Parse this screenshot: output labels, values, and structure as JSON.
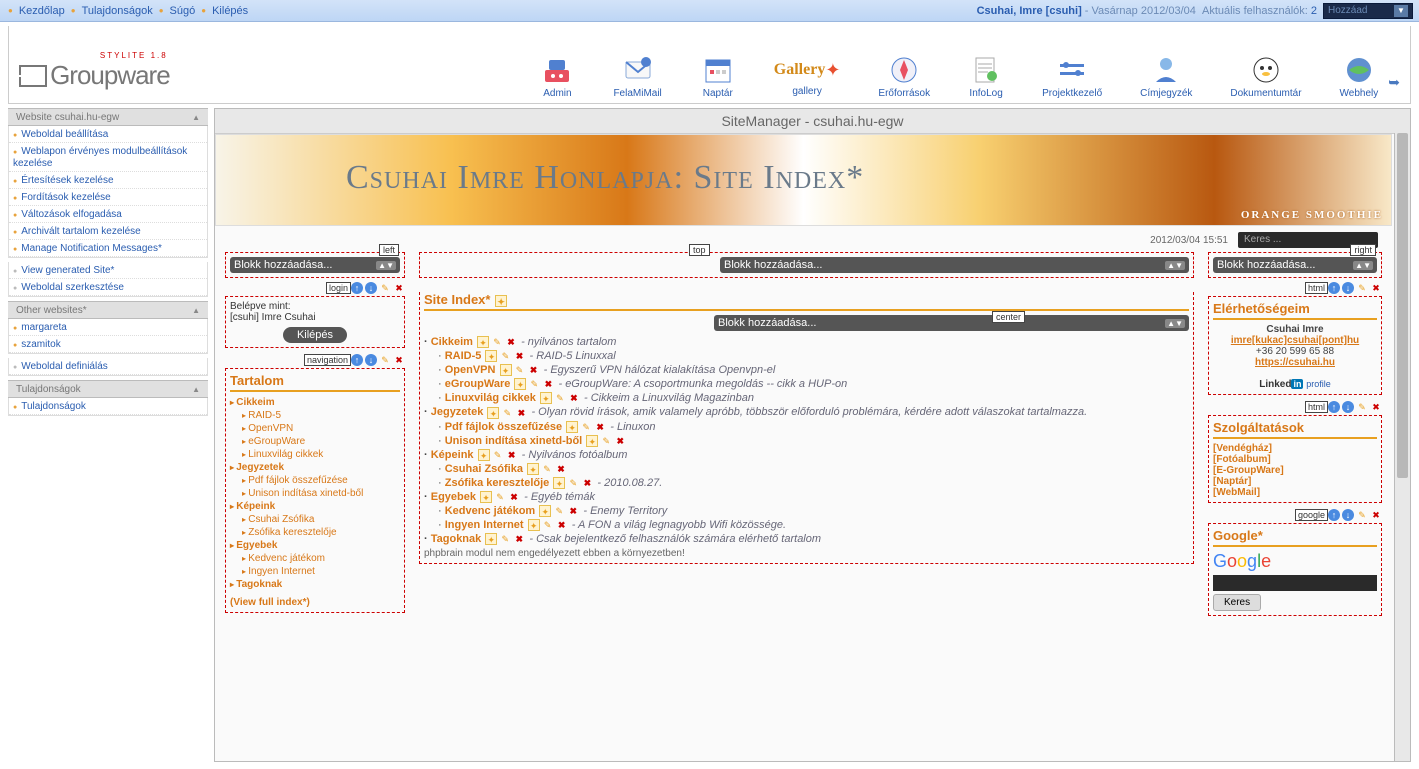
{
  "topbar": {
    "links": [
      "Kezdőlap",
      "Tulajdonságok",
      "Súgó",
      "Kilépés"
    ],
    "user_label": "Csuhai, Imre [csuhi]",
    "date_label": " - Vasárnap 2012/03/04",
    "users_label": "Aktuális felhasználók:",
    "users_count": "2",
    "dropdown": "Hozzáad"
  },
  "logo": {
    "sub": "STYLITE 1.8",
    "text": "Groupware"
  },
  "apps": [
    {
      "label": "Admin"
    },
    {
      "label": "FelaMiMail"
    },
    {
      "label": "Naptár"
    },
    {
      "label": "gallery"
    },
    {
      "label": "Erőforrások"
    },
    {
      "label": "InfoLog"
    },
    {
      "label": "Projektkezelő"
    },
    {
      "label": "Címjegyzék"
    },
    {
      "label": "Dokumentumtár"
    },
    {
      "label": "Webhely"
    }
  ],
  "sidebar": {
    "section1": {
      "title": "Website csuhai.hu-egw",
      "items": [
        "Weboldal beállítása",
        "Weblapon érvényes modulbeállítások kezelése",
        "Értesítések kezelése",
        "Fordítások kezelése",
        "Változások elfogadása",
        "Archivált tartalom kezelése",
        "Manage Notification Messages*"
      ],
      "items2": [
        "View generated Site*",
        "Weboldal szerkesztése"
      ]
    },
    "section2": {
      "title": "Other websites*",
      "items": [
        "margareta",
        "szamitok"
      ],
      "items2": [
        "Weboldal definiálás"
      ]
    },
    "section3": {
      "title": "Tulajdonságok",
      "items": [
        "Tulajdonságok"
      ]
    }
  },
  "main": {
    "title": "SiteManager - csuhai.hu-egw",
    "banner_title": "Csuhai Imre Honlapja: Site Index*",
    "banner_brand": "ORANGE SMOOTHIE",
    "timestamp": "2012/03/04 15:51",
    "search_placeholder": "Keres ...",
    "add_block": "Blokk hozzáadása..."
  },
  "zones": {
    "left": "left",
    "top": "top",
    "right": "right",
    "center": "center"
  },
  "left_blocks": {
    "login": {
      "tag": "login",
      "text1": "Belépve mint:",
      "text2": "[csuhi] Imre Csuhai",
      "btn": "Kilépés"
    },
    "nav": {
      "tag": "navigation",
      "title": "Tartalom",
      "footer": "(View full index*)",
      "items": [
        {
          "t": "Cikkeim",
          "sub": [
            "RAID-5",
            "OpenVPN",
            "eGroupWare",
            "Linuxvilág cikkek"
          ]
        },
        {
          "t": "Jegyzetek",
          "sub": [
            "Pdf fájlok összefűzése",
            "Unison indítása xinetd-ből"
          ]
        },
        {
          "t": "Képeink",
          "sub": [
            "Csuhai Zsófika",
            "Zsófika keresztelője"
          ]
        },
        {
          "t": "Egyebek",
          "sub": [
            "Kedvenc játékom",
            "Ingyen Internet"
          ]
        },
        {
          "t": "Tagoknak",
          "sub": []
        }
      ]
    }
  },
  "center": {
    "title": "Site Index*",
    "items": [
      {
        "lvl": 1,
        "t": "Cikkeim",
        "d": "nyilvános tartalom"
      },
      {
        "lvl": 2,
        "t": "RAID-5",
        "d": "RAID-5 Linuxxal"
      },
      {
        "lvl": 2,
        "t": "OpenVPN",
        "d": "Egyszerű VPN hálózat kialakítása Openvpn-el"
      },
      {
        "lvl": 2,
        "t": "eGroupWare",
        "d": "eGroupWare: A csoportmunka megoldás -- cikk a HUP-on"
      },
      {
        "lvl": 2,
        "t": "Linuxvilág cikkek",
        "d": "Cikkeim a Linuxvilág Magazinban"
      },
      {
        "lvl": 1,
        "t": "Jegyzetek",
        "d": "Olyan rövid írások, amik valamely apróbb, többször előforduló problémára, kérdére adott válaszokat tartalmazza."
      },
      {
        "lvl": 2,
        "t": "Pdf fájlok összefűzése",
        "d": "Linuxon"
      },
      {
        "lvl": 2,
        "t": "Unison indítása xinetd-ből",
        "d": ""
      },
      {
        "lvl": 1,
        "t": "Képeink",
        "d": "Nyilvános fotóalbum"
      },
      {
        "lvl": 2,
        "t": "Csuhai Zsófika",
        "d": ""
      },
      {
        "lvl": 2,
        "t": "Zsófika keresztelője",
        "d": "2010.08.27."
      },
      {
        "lvl": 1,
        "t": "Egyebek",
        "d": "Egyéb témák"
      },
      {
        "lvl": 2,
        "t": "Kedvenc játékom",
        "d": "Enemy Territory"
      },
      {
        "lvl": 2,
        "t": "Ingyen Internet",
        "d": "A FON a világ legnagyobb Wifi közössége."
      },
      {
        "lvl": 1,
        "t": "Tagoknak",
        "d": "Csak bejelentkező felhasználók számára elérhető tartalom"
      }
    ],
    "footer": "phpbrain modul nem engedélyezett ebben a környezetben!"
  },
  "right": {
    "contact": {
      "tag": "html",
      "title": "Elérhetőségeim",
      "name": "Csuhai Imre",
      "email": "imre[kukac]csuhai[pont]hu",
      "phone": "+36 20 599 65 88",
      "url": "https://csuhai.hu",
      "linkedin": "profile"
    },
    "services": {
      "tag": "html",
      "title": "Szolgáltatások",
      "items": [
        "[Vendégház]",
        "[Fotóalbum]",
        "[E-GroupWare]",
        "[Naptár]",
        "[WebMail]"
      ]
    },
    "google": {
      "tag": "google",
      "title": "Google*",
      "btn": "Keres"
    }
  }
}
